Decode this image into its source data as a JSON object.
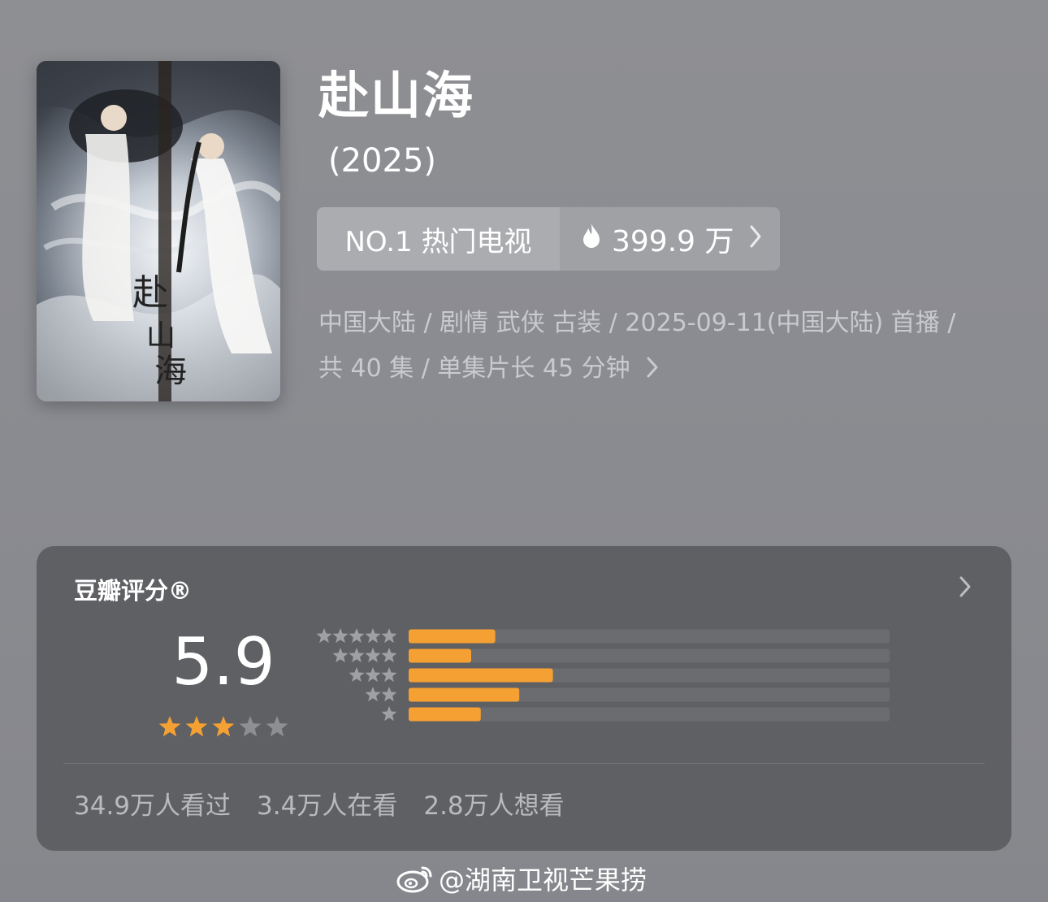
{
  "title": "赴山海",
  "year": "(2025)",
  "rank": {
    "label": "NO.1 热门电视",
    "heat": "399.9 万"
  },
  "meta": {
    "line1": "中国大陆 / 剧情 武侠 古装 / 2025-09-11(中国大陆) 首播 /",
    "line2": "共 40 集 / 单集片长 45 分钟"
  },
  "rating": {
    "label": "豆瓣评分®",
    "score": "5.9",
    "stars_filled": 3,
    "stars_total": 5,
    "distribution": [
      {
        "stars": 5,
        "fraction": 0.18
      },
      {
        "stars": 4,
        "fraction": 0.13
      },
      {
        "stars": 3,
        "fraction": 0.3
      },
      {
        "stars": 2,
        "fraction": 0.23
      },
      {
        "stars": 1,
        "fraction": 0.15
      }
    ],
    "accent": "#f5a032"
  },
  "stats": {
    "watched": "34.9万人看过",
    "watching": "3.4万人在看",
    "want": "2.8万人想看"
  },
  "watermark": "@湖南卫视芒果捞"
}
